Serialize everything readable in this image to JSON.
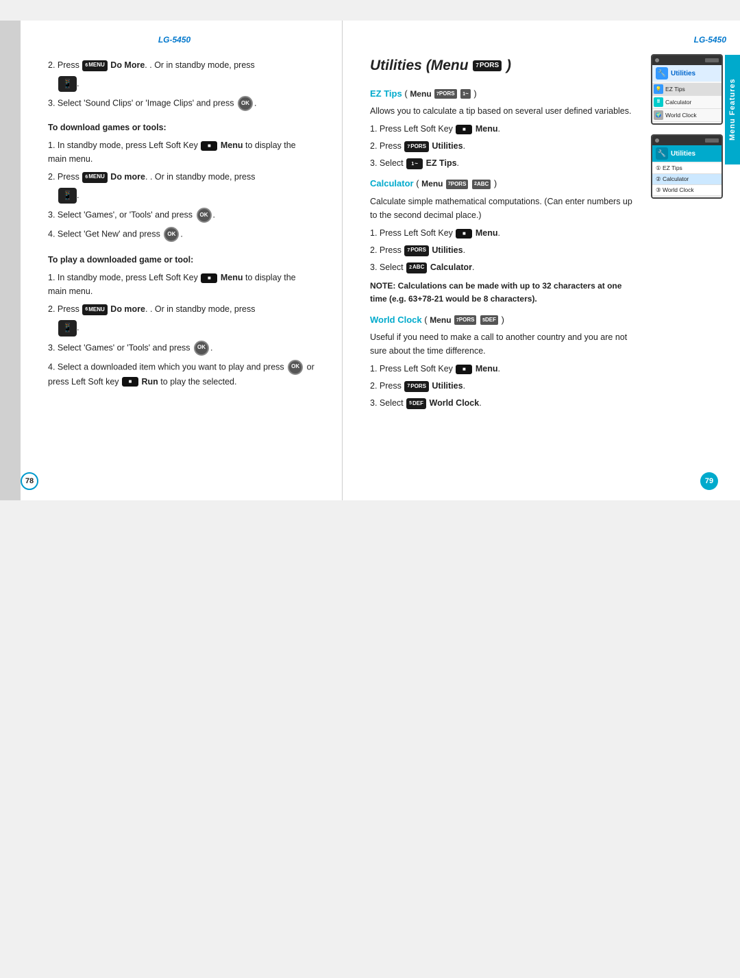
{
  "left_page": {
    "model": "LG-5450",
    "page_number": "78",
    "content": {
      "step2_a": "2. Press",
      "step2_a_btn": "6MENU",
      "step2_a_bold": "Do More",
      "step2_a_rest": ". Or in standby mode, press",
      "step3_a": "3. Select 'Sound Clips' or 'Image Clips' and press",
      "section1_title": "To download games or tools:",
      "s1_step1": "1. In standby mode, press Left Soft Key",
      "s1_step1_btn": "Menu",
      "s1_step1_rest": "to display the main menu.",
      "s1_step2": "2. Press",
      "s1_step2_btn": "6MENU",
      "s1_step2_bold": "Do more",
      "s1_step2_rest": ". Or in standby mode, press",
      "s1_step3": "3. Select 'Games', or 'Tools' and press",
      "s1_step4": "4. Select 'Get New' and press",
      "section2_title": "To play a downloaded game or tool:",
      "s2_step1": "1. In standby mode, press Left Soft Key",
      "s2_step1_btn": "Menu",
      "s2_step1_rest": "to display the main menu.",
      "s2_step2": "2. Press",
      "s2_step2_btn": "6MENU",
      "s2_step2_bold": "Do more",
      "s2_step2_rest": ". Or in standby mode, press",
      "s2_step3": "3. Select 'Games' or 'Tools' and press",
      "s2_step4_start": "4. Select a downloaded item which you want to play and press",
      "s2_step4_or": "or press Left Soft key",
      "s2_step4_run": "Run",
      "s2_step4_end": "to play the selected."
    }
  },
  "right_page": {
    "model": "LG-5450",
    "page_number": "79",
    "sidebar_label": "Menu Features",
    "title": "Utilities (Menu 7",
    "title_pors": "PORS",
    "title_end": ")",
    "sections": {
      "ez_tips": {
        "heading": "EZ Tips",
        "menu_label": "Menu",
        "menu_num": "7PORS",
        "menu_sub": "1~",
        "description": "Allows you to calculate a tip based on several user defined variables.",
        "step1": "1. Press Left Soft Key",
        "step1_btn": "Menu",
        "step2": "2. Press",
        "step2_btn": "7PORS",
        "step2_bold": "Utilities",
        "step3": "3. Select",
        "step3_btn": "1~",
        "step3_bold": "EZ Tips",
        "step3_end": "."
      },
      "calculator": {
        "heading": "Calculator",
        "menu_label": "Menu",
        "menu_num": "7PORS",
        "menu_sub": "2ABC",
        "description": "Calculate simple mathematical computations. (Can enter numbers up to the second decimal place.)",
        "step1": "1. Press Left Soft Key",
        "step1_btn": "Menu",
        "step2": "2. Press",
        "step2_btn": "7PORS",
        "step2_bold": "Utilities",
        "step3": "3. Select",
        "step3_btn": "2ABC",
        "step3_bold": "Calculator",
        "step3_end": ".",
        "note": "NOTE: Calculations can be made with up to 32 characters at one time (e.g. 63+78-21 would be 8 characters)."
      },
      "world_clock": {
        "heading": "World Clock",
        "menu_label": "Menu",
        "menu_num": "7PORS",
        "menu_sub": "5DEF",
        "description": "Useful if you need to make a call to another country and you are not sure about the time difference.",
        "step1": "1. Press Left Soft Key",
        "step1_btn": "Menu",
        "step2": "2. Press",
        "step2_btn": "7PORS",
        "step2_bold": "Utilities",
        "step3": "3. Select",
        "step3_btn": "5DEF",
        "step3_bold": "World Clock",
        "step3_end": "."
      }
    },
    "screen1": {
      "items": [
        "Utilities",
        "EZ Tips",
        "Calculator",
        "World Clock"
      ]
    },
    "screen2": {
      "items": [
        "EZ Tips",
        "Calculator",
        "World Clock"
      ]
    }
  }
}
